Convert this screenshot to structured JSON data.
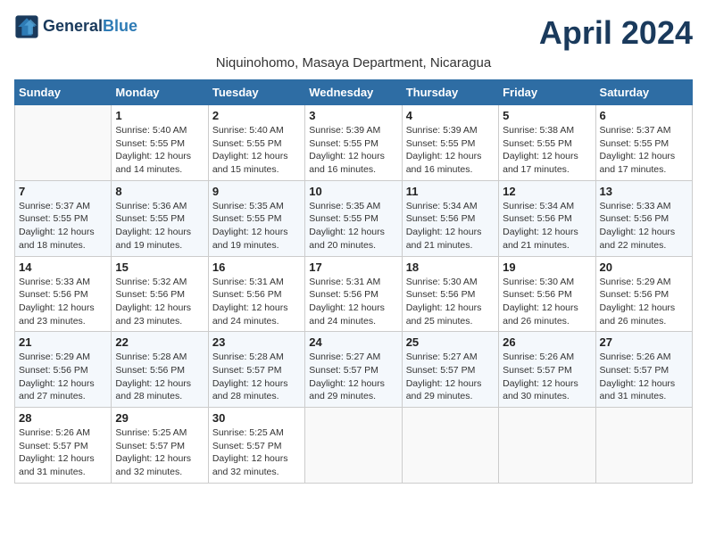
{
  "header": {
    "logo_line1": "General",
    "logo_line2": "Blue",
    "month_title": "April 2024",
    "subtitle": "Niquinohomo, Masaya Department, Nicaragua"
  },
  "weekdays": [
    "Sunday",
    "Monday",
    "Tuesday",
    "Wednesday",
    "Thursday",
    "Friday",
    "Saturday"
  ],
  "weeks": [
    [
      {
        "day": "",
        "info": ""
      },
      {
        "day": "1",
        "info": "Sunrise: 5:40 AM\nSunset: 5:55 PM\nDaylight: 12 hours\nand 14 minutes."
      },
      {
        "day": "2",
        "info": "Sunrise: 5:40 AM\nSunset: 5:55 PM\nDaylight: 12 hours\nand 15 minutes."
      },
      {
        "day": "3",
        "info": "Sunrise: 5:39 AM\nSunset: 5:55 PM\nDaylight: 12 hours\nand 16 minutes."
      },
      {
        "day": "4",
        "info": "Sunrise: 5:39 AM\nSunset: 5:55 PM\nDaylight: 12 hours\nand 16 minutes."
      },
      {
        "day": "5",
        "info": "Sunrise: 5:38 AM\nSunset: 5:55 PM\nDaylight: 12 hours\nand 17 minutes."
      },
      {
        "day": "6",
        "info": "Sunrise: 5:37 AM\nSunset: 5:55 PM\nDaylight: 12 hours\nand 17 minutes."
      }
    ],
    [
      {
        "day": "7",
        "info": "Sunrise: 5:37 AM\nSunset: 5:55 PM\nDaylight: 12 hours\nand 18 minutes."
      },
      {
        "day": "8",
        "info": "Sunrise: 5:36 AM\nSunset: 5:55 PM\nDaylight: 12 hours\nand 19 minutes."
      },
      {
        "day": "9",
        "info": "Sunrise: 5:35 AM\nSunset: 5:55 PM\nDaylight: 12 hours\nand 19 minutes."
      },
      {
        "day": "10",
        "info": "Sunrise: 5:35 AM\nSunset: 5:55 PM\nDaylight: 12 hours\nand 20 minutes."
      },
      {
        "day": "11",
        "info": "Sunrise: 5:34 AM\nSunset: 5:56 PM\nDaylight: 12 hours\nand 21 minutes."
      },
      {
        "day": "12",
        "info": "Sunrise: 5:34 AM\nSunset: 5:56 PM\nDaylight: 12 hours\nand 21 minutes."
      },
      {
        "day": "13",
        "info": "Sunrise: 5:33 AM\nSunset: 5:56 PM\nDaylight: 12 hours\nand 22 minutes."
      }
    ],
    [
      {
        "day": "14",
        "info": "Sunrise: 5:33 AM\nSunset: 5:56 PM\nDaylight: 12 hours\nand 23 minutes."
      },
      {
        "day": "15",
        "info": "Sunrise: 5:32 AM\nSunset: 5:56 PM\nDaylight: 12 hours\nand 23 minutes."
      },
      {
        "day": "16",
        "info": "Sunrise: 5:31 AM\nSunset: 5:56 PM\nDaylight: 12 hours\nand 24 minutes."
      },
      {
        "day": "17",
        "info": "Sunrise: 5:31 AM\nSunset: 5:56 PM\nDaylight: 12 hours\nand 24 minutes."
      },
      {
        "day": "18",
        "info": "Sunrise: 5:30 AM\nSunset: 5:56 PM\nDaylight: 12 hours\nand 25 minutes."
      },
      {
        "day": "19",
        "info": "Sunrise: 5:30 AM\nSunset: 5:56 PM\nDaylight: 12 hours\nand 26 minutes."
      },
      {
        "day": "20",
        "info": "Sunrise: 5:29 AM\nSunset: 5:56 PM\nDaylight: 12 hours\nand 26 minutes."
      }
    ],
    [
      {
        "day": "21",
        "info": "Sunrise: 5:29 AM\nSunset: 5:56 PM\nDaylight: 12 hours\nand 27 minutes."
      },
      {
        "day": "22",
        "info": "Sunrise: 5:28 AM\nSunset: 5:56 PM\nDaylight: 12 hours\nand 28 minutes."
      },
      {
        "day": "23",
        "info": "Sunrise: 5:28 AM\nSunset: 5:57 PM\nDaylight: 12 hours\nand 28 minutes."
      },
      {
        "day": "24",
        "info": "Sunrise: 5:27 AM\nSunset: 5:57 PM\nDaylight: 12 hours\nand 29 minutes."
      },
      {
        "day": "25",
        "info": "Sunrise: 5:27 AM\nSunset: 5:57 PM\nDaylight: 12 hours\nand 29 minutes."
      },
      {
        "day": "26",
        "info": "Sunrise: 5:26 AM\nSunset: 5:57 PM\nDaylight: 12 hours\nand 30 minutes."
      },
      {
        "day": "27",
        "info": "Sunrise: 5:26 AM\nSunset: 5:57 PM\nDaylight: 12 hours\nand 31 minutes."
      }
    ],
    [
      {
        "day": "28",
        "info": "Sunrise: 5:26 AM\nSunset: 5:57 PM\nDaylight: 12 hours\nand 31 minutes."
      },
      {
        "day": "29",
        "info": "Sunrise: 5:25 AM\nSunset: 5:57 PM\nDaylight: 12 hours\nand 32 minutes."
      },
      {
        "day": "30",
        "info": "Sunrise: 5:25 AM\nSunset: 5:57 PM\nDaylight: 12 hours\nand 32 minutes."
      },
      {
        "day": "",
        "info": ""
      },
      {
        "day": "",
        "info": ""
      },
      {
        "day": "",
        "info": ""
      },
      {
        "day": "",
        "info": ""
      }
    ]
  ]
}
